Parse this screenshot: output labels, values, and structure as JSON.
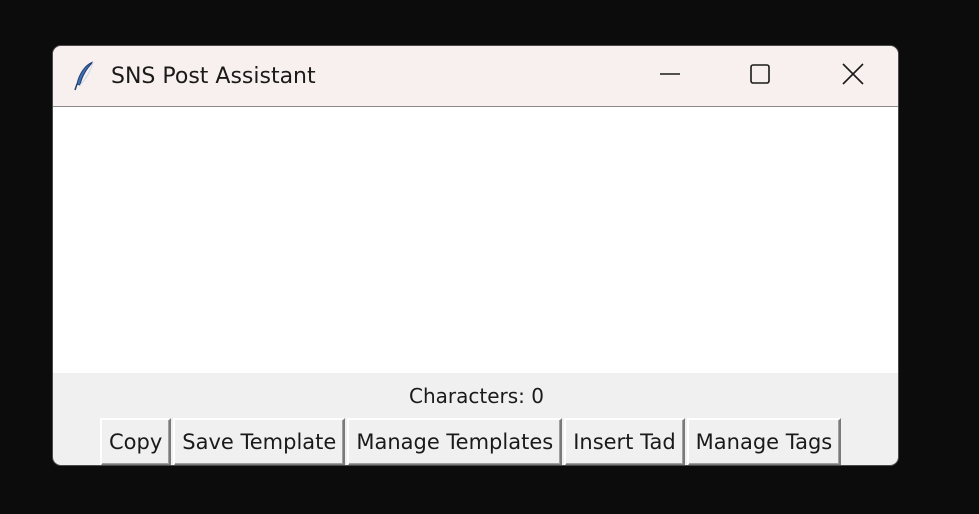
{
  "window": {
    "title": "SNS Post Assistant",
    "icon": "feather-icon",
    "controls": {
      "minimize_icon": "minimize-icon",
      "maximize_icon": "maximize-icon",
      "close_icon": "close-icon"
    }
  },
  "editor": {
    "value": ""
  },
  "status": {
    "character_count_label": "Characters: 0"
  },
  "buttons": {
    "copy": "Copy",
    "save_template": "Save Template",
    "manage_templates": "Manage Templates",
    "insert_tag": "Insert Tad",
    "manage_tags": "Manage Tags"
  },
  "colors": {
    "titlebar": "#f8f0ee",
    "window_body": "#f0f0f0",
    "desktop": "#0c0c0c",
    "editor_bg": "#ffffff"
  }
}
